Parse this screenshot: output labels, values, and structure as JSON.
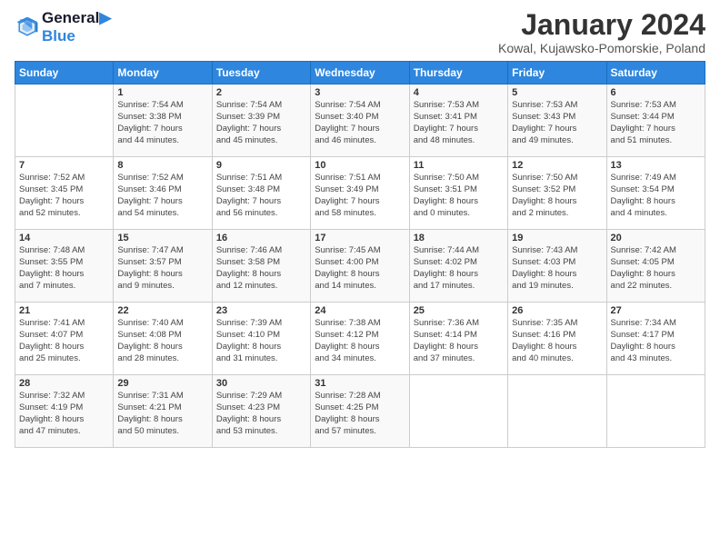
{
  "logo": {
    "line1": "General",
    "line2": "Blue"
  },
  "header": {
    "title": "January 2024",
    "subtitle": "Kowal, Kujawsko-Pomorskie, Poland"
  },
  "days_of_week": [
    "Sunday",
    "Monday",
    "Tuesday",
    "Wednesday",
    "Thursday",
    "Friday",
    "Saturday"
  ],
  "weeks": [
    [
      {
        "day": "",
        "content": ""
      },
      {
        "day": "1",
        "content": "Sunrise: 7:54 AM\nSunset: 3:38 PM\nDaylight: 7 hours\nand 44 minutes."
      },
      {
        "day": "2",
        "content": "Sunrise: 7:54 AM\nSunset: 3:39 PM\nDaylight: 7 hours\nand 45 minutes."
      },
      {
        "day": "3",
        "content": "Sunrise: 7:54 AM\nSunset: 3:40 PM\nDaylight: 7 hours\nand 46 minutes."
      },
      {
        "day": "4",
        "content": "Sunrise: 7:53 AM\nSunset: 3:41 PM\nDaylight: 7 hours\nand 48 minutes."
      },
      {
        "day": "5",
        "content": "Sunrise: 7:53 AM\nSunset: 3:43 PM\nDaylight: 7 hours\nand 49 minutes."
      },
      {
        "day": "6",
        "content": "Sunrise: 7:53 AM\nSunset: 3:44 PM\nDaylight: 7 hours\nand 51 minutes."
      }
    ],
    [
      {
        "day": "7",
        "content": "Sunrise: 7:52 AM\nSunset: 3:45 PM\nDaylight: 7 hours\nand 52 minutes."
      },
      {
        "day": "8",
        "content": "Sunrise: 7:52 AM\nSunset: 3:46 PM\nDaylight: 7 hours\nand 54 minutes."
      },
      {
        "day": "9",
        "content": "Sunrise: 7:51 AM\nSunset: 3:48 PM\nDaylight: 7 hours\nand 56 minutes."
      },
      {
        "day": "10",
        "content": "Sunrise: 7:51 AM\nSunset: 3:49 PM\nDaylight: 7 hours\nand 58 minutes."
      },
      {
        "day": "11",
        "content": "Sunrise: 7:50 AM\nSunset: 3:51 PM\nDaylight: 8 hours\nand 0 minutes."
      },
      {
        "day": "12",
        "content": "Sunrise: 7:50 AM\nSunset: 3:52 PM\nDaylight: 8 hours\nand 2 minutes."
      },
      {
        "day": "13",
        "content": "Sunrise: 7:49 AM\nSunset: 3:54 PM\nDaylight: 8 hours\nand 4 minutes."
      }
    ],
    [
      {
        "day": "14",
        "content": "Sunrise: 7:48 AM\nSunset: 3:55 PM\nDaylight: 8 hours\nand 7 minutes."
      },
      {
        "day": "15",
        "content": "Sunrise: 7:47 AM\nSunset: 3:57 PM\nDaylight: 8 hours\nand 9 minutes."
      },
      {
        "day": "16",
        "content": "Sunrise: 7:46 AM\nSunset: 3:58 PM\nDaylight: 8 hours\nand 12 minutes."
      },
      {
        "day": "17",
        "content": "Sunrise: 7:45 AM\nSunset: 4:00 PM\nDaylight: 8 hours\nand 14 minutes."
      },
      {
        "day": "18",
        "content": "Sunrise: 7:44 AM\nSunset: 4:02 PM\nDaylight: 8 hours\nand 17 minutes."
      },
      {
        "day": "19",
        "content": "Sunrise: 7:43 AM\nSunset: 4:03 PM\nDaylight: 8 hours\nand 19 minutes."
      },
      {
        "day": "20",
        "content": "Sunrise: 7:42 AM\nSunset: 4:05 PM\nDaylight: 8 hours\nand 22 minutes."
      }
    ],
    [
      {
        "day": "21",
        "content": "Sunrise: 7:41 AM\nSunset: 4:07 PM\nDaylight: 8 hours\nand 25 minutes."
      },
      {
        "day": "22",
        "content": "Sunrise: 7:40 AM\nSunset: 4:08 PM\nDaylight: 8 hours\nand 28 minutes."
      },
      {
        "day": "23",
        "content": "Sunrise: 7:39 AM\nSunset: 4:10 PM\nDaylight: 8 hours\nand 31 minutes."
      },
      {
        "day": "24",
        "content": "Sunrise: 7:38 AM\nSunset: 4:12 PM\nDaylight: 8 hours\nand 34 minutes."
      },
      {
        "day": "25",
        "content": "Sunrise: 7:36 AM\nSunset: 4:14 PM\nDaylight: 8 hours\nand 37 minutes."
      },
      {
        "day": "26",
        "content": "Sunrise: 7:35 AM\nSunset: 4:16 PM\nDaylight: 8 hours\nand 40 minutes."
      },
      {
        "day": "27",
        "content": "Sunrise: 7:34 AM\nSunset: 4:17 PM\nDaylight: 8 hours\nand 43 minutes."
      }
    ],
    [
      {
        "day": "28",
        "content": "Sunrise: 7:32 AM\nSunset: 4:19 PM\nDaylight: 8 hours\nand 47 minutes."
      },
      {
        "day": "29",
        "content": "Sunrise: 7:31 AM\nSunset: 4:21 PM\nDaylight: 8 hours\nand 50 minutes."
      },
      {
        "day": "30",
        "content": "Sunrise: 7:29 AM\nSunset: 4:23 PM\nDaylight: 8 hours\nand 53 minutes."
      },
      {
        "day": "31",
        "content": "Sunrise: 7:28 AM\nSunset: 4:25 PM\nDaylight: 8 hours\nand 57 minutes."
      },
      {
        "day": "",
        "content": ""
      },
      {
        "day": "",
        "content": ""
      },
      {
        "day": "",
        "content": ""
      }
    ]
  ]
}
